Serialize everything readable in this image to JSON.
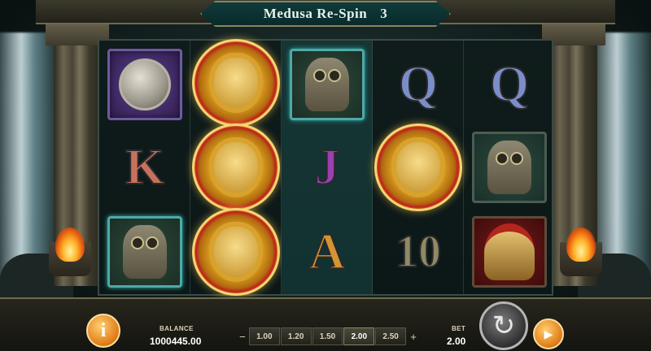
{
  "header": {
    "title": "Medusa Re-Spin",
    "count": "3"
  },
  "reels": {
    "columns": [
      [
        "coin-tile",
        "K",
        "owl-tile"
      ],
      [
        "medusa",
        "medusa",
        "medusa"
      ],
      [
        "owl-tile",
        "J",
        "A"
      ],
      [
        "Q",
        "medusa",
        "10"
      ],
      [
        "Q",
        "owl-green",
        "helmet"
      ]
    ],
    "letters": {
      "K": "K",
      "J": "J",
      "A": "A",
      "Q1": "Q",
      "Q2": "Q",
      "ten": "10"
    }
  },
  "footer": {
    "info_label": "i",
    "balance_label": "BALANCE",
    "balance_value": "1000445.00",
    "bet_minus": "−",
    "bet_plus": "+",
    "bet_options": [
      "1.00",
      "1.20",
      "1.50",
      "2.00",
      "2.50"
    ],
    "bet_selected": "2.00",
    "bet_label": "BET",
    "bet_value": "2.00",
    "spin_icon": "refresh-icon",
    "autoplay_icon": "play-icon"
  },
  "colors": {
    "accent_gold": "#f0c245",
    "frame": "#6f6a4f",
    "highlight_teal": "#4fa9a8"
  }
}
